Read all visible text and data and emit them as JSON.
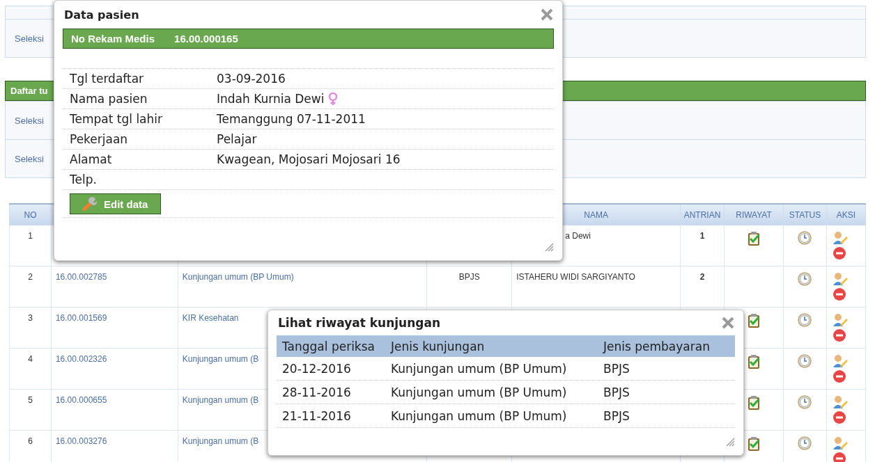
{
  "filter_panel": {
    "label": "Seleksi"
  },
  "list_panel": {
    "title": "Daftar tu",
    "filters": [
      {
        "label": "Seleksi"
      },
      {
        "label": "Seleksi"
      }
    ]
  },
  "table": {
    "columns": [
      "NO",
      "NAMA",
      "ANTRIAN",
      "RIWAYAT",
      "STATUS",
      "AKSI"
    ],
    "rows": [
      {
        "no": "1",
        "nama": "a Dewi",
        "antrian": "1",
        "riwayat": true
      },
      {
        "no": "2",
        "no_rm": "16.00.002785",
        "jenis": "Kunjungan umum (BP Umum)",
        "bayar": "BPJS",
        "nama": "ISTAHERU WIDI SARGIYANTO",
        "antrian": "2",
        "riwayat": false
      },
      {
        "no": "3",
        "no_rm": "16.00.001569",
        "jenis": "KIR Kesehatan",
        "riwayat": true
      },
      {
        "no": "4",
        "no_rm": "16.00.002326",
        "jenis": "Kunjungan umum (B",
        "riwayat": true
      },
      {
        "no": "5",
        "no_rm": "16.00.000655",
        "jenis": "Kunjungan umum (B",
        "riwayat": true
      },
      {
        "no": "6",
        "no_rm": "16.00.003276",
        "jenis": "Kunjungan umum (B",
        "riwayat": true
      }
    ]
  },
  "patient_dialog": {
    "title": "Data pasien",
    "record_label": "No Rekam Medis",
    "record_number": "16.00.000165",
    "fields": [
      {
        "label": "Tgl terdaftar",
        "value": "03-09-2016"
      },
      {
        "label": "Nama pasien",
        "value": "Indah Kurnia Dewi",
        "female": true
      },
      {
        "label": "Tempat tgl lahir",
        "value": "Temanggung 07-11-2011"
      },
      {
        "label": "Pekerjaan",
        "value": "Pelajar"
      },
      {
        "label": "Alamat",
        "value": "Kwagean, Mojosari Mojosari 16"
      },
      {
        "label": "Telp."
      }
    ],
    "edit_button": "Edit data"
  },
  "history_dialog": {
    "title": "Lihat riwayat kunjungan",
    "columns": [
      "Tanggal periksa",
      "Jenis kunjungan",
      "Jenis pembayaran"
    ],
    "rows": [
      [
        "20-12-2016",
        "Kunjungan umum (BP Umum)",
        "BPJS"
      ],
      [
        "28-11-2016",
        "Kunjungan umum (BP Umum)",
        "BPJS"
      ],
      [
        "21-11-2016",
        "Kunjungan umum (BP Umum)",
        "BPJS"
      ]
    ]
  }
}
